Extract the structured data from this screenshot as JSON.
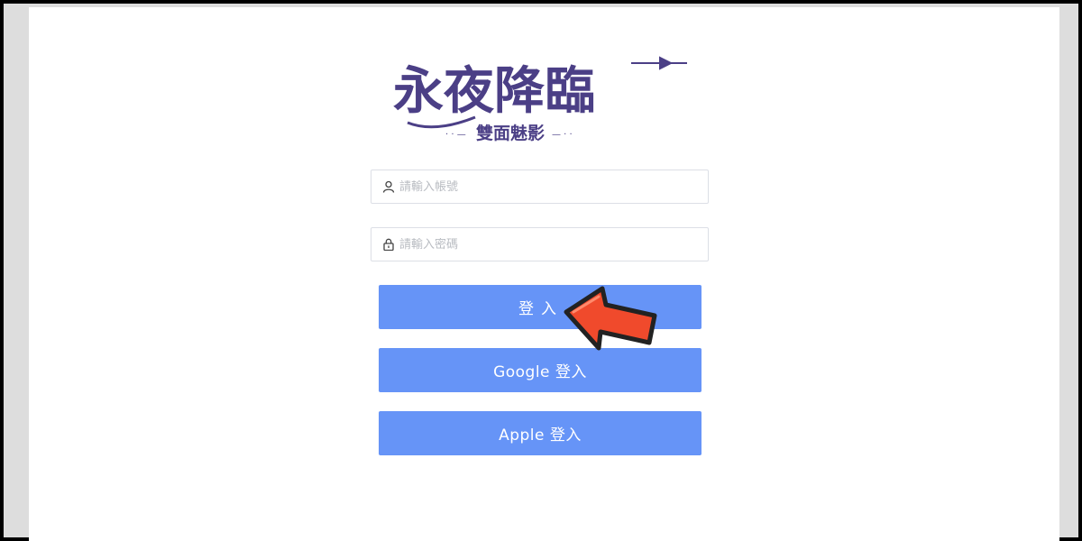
{
  "logo": {
    "title": "永夜降臨",
    "subtitle": "雙面魅影"
  },
  "form": {
    "account_placeholder": "請輸入帳號",
    "password_placeholder": "請輸入密碼"
  },
  "buttons": {
    "login": "登入",
    "google_login": "Google 登入",
    "apple_login": "Apple 登入"
  },
  "colors": {
    "button": "#6694f7",
    "logo": "#4b3f86",
    "arrow": "#f04a2c"
  },
  "icons": {
    "account": "user-icon",
    "password": "lock-icon",
    "annotation": "red-arrow-icon"
  }
}
